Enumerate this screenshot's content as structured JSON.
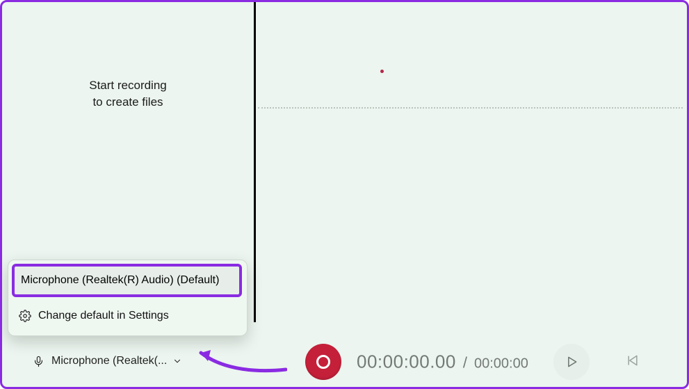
{
  "sidebar": {
    "empty_line1": "Start recording",
    "empty_line2": "to create files"
  },
  "flyout": {
    "option_default": "Microphone (Realtek(R) Audio) (Default)",
    "settings_label": "Change default in Settings"
  },
  "bottom": {
    "mic_label": "Microphone (Realtek(...",
    "elapsed": "00:00:00.00",
    "separator": "/",
    "total": "00:00:00"
  },
  "colors": {
    "accent_purple": "#8a2be2",
    "record_red": "#c5203a",
    "bg_mint": "#ecf5ef"
  }
}
